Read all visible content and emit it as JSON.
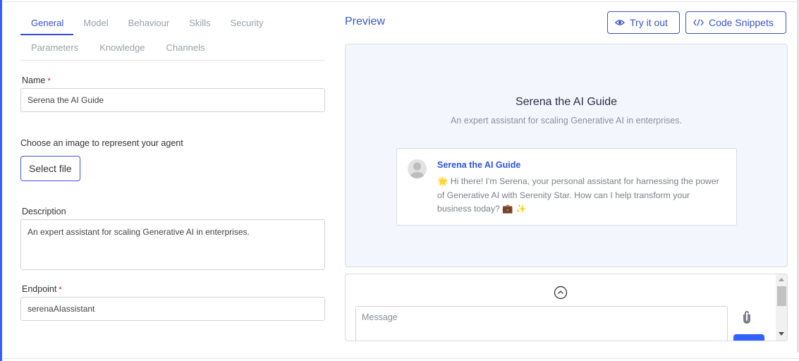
{
  "tabs": {
    "row1": [
      {
        "label": "General",
        "active": true
      },
      {
        "label": "Model",
        "active": false
      },
      {
        "label": "Behaviour",
        "active": false
      },
      {
        "label": "Skills",
        "active": false
      },
      {
        "label": "Security",
        "active": false
      }
    ],
    "row2": [
      {
        "label": "Parameters",
        "active": false
      },
      {
        "label": "Knowledge",
        "active": false
      },
      {
        "label": "Channels",
        "active": false
      }
    ]
  },
  "form": {
    "name": {
      "label": "Name",
      "required_mark": "*",
      "value": "Serena the AI Guide"
    },
    "image": {
      "label": "Choose an image to represent your agent",
      "button_label": "Select file"
    },
    "description": {
      "label": "Description",
      "value": "An expert assistant for scaling Generative AI in enterprises."
    },
    "endpoint": {
      "label": "Endpoint",
      "required_mark": "*",
      "value": "serenaAIassistant"
    }
  },
  "preview": {
    "title": "Preview",
    "try_button": {
      "label": "Try it out",
      "icon": "eye-icon"
    },
    "code_button": {
      "label": "Code Snippets",
      "icon": "code-icon"
    },
    "agent_name": "Serena the AI Guide",
    "agent_description": "An expert assistant for scaling Generative AI in enterprises.",
    "message": {
      "sender": "Serena the AI Guide",
      "text": "🌟 Hi there! I'm Serena, your personal assistant for harnessing the power of Generative AI with Serenity Star. How can I help transform your business today? 💼 ✨"
    },
    "chat": {
      "message_placeholder": "Message",
      "collapse_icon": "chevron-up-circle-icon",
      "attach_icon": "paperclip-icon"
    }
  },
  "colors": {
    "accent": "#3450d6",
    "send_button": "#3263ff",
    "preview_bg": "#f3f6fd",
    "left_accent_bar": "#3b5bff",
    "required": "#e0002a"
  }
}
